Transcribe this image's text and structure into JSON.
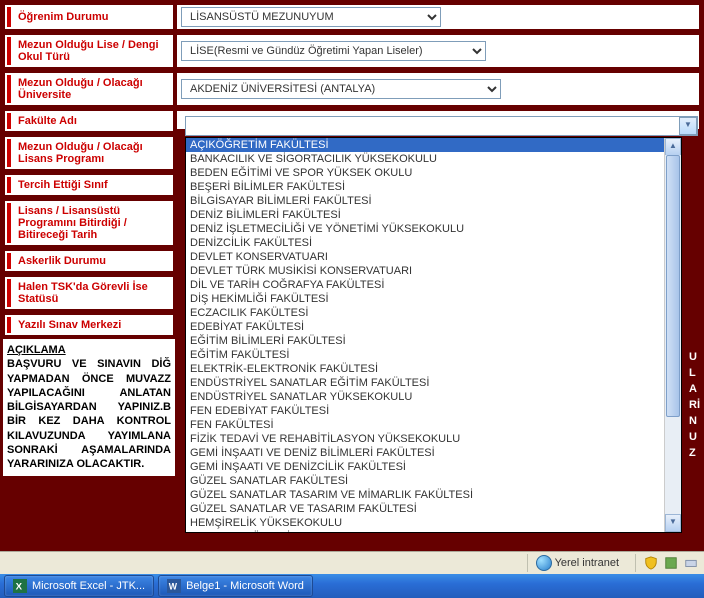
{
  "rows": {
    "ogrenim": {
      "label": "Öğrenim Durumu",
      "value": "LİSANSÜSTÜ MEZUNUYUM"
    },
    "lise": {
      "label": "Mezun Olduğu Lise / Dengi Okul Türü",
      "value": "LİSE(Resmi ve Gündüz Öğretimi Yapan Liseler)"
    },
    "uni": {
      "label": "Mezun Olduğu / Olacağı Üniversite",
      "value": "AKDENİZ ÜNİVERSİTESİ (ANTALYA)"
    },
    "fakulte": {
      "label": "Fakülte Adı",
      "value": ""
    },
    "program": {
      "label": "Mezun Olduğu / Olacağı Lisans Programı"
    },
    "tercih": {
      "label": "Tercih Ettiği Sınıf"
    },
    "bitir": {
      "label": "Lisans / Lisansüstü Programını Bitirdiği / Bitireceği Tarih"
    },
    "asker": {
      "label": "Askerlik Durumu"
    },
    "tsk": {
      "label": "Halen TSK'da Görevli İse Statüsü"
    },
    "merkez": {
      "label": "Yazılı Sınav Merkezi"
    }
  },
  "explain": {
    "title": "AÇIKLAMA",
    "body": "BAŞVURU VE SINAVIN DİĞ YAPMADAN ÖNCE MUVAZZ YAPILACAĞINI ANLATAN BİLGİSAYARDAN YAPINIZ.B BİR KEZ DAHA KONTROL KILAVUZUNDA YAYIMLANA SONRAKİ AŞAMALARINDA YARARINIZA OLACAKTIR."
  },
  "right_letters": [
    "U",
    "L",
    "A",
    "Rİ",
    "N",
    "U",
    "Z"
  ],
  "dropdown": {
    "selected": "AÇIKÖĞRETİM FAKÜLTESİ",
    "items": [
      "AÇIKÖĞRETİM FAKÜLTESİ",
      "BANKACILIK VE SİGORTACILIK YÜKSEKOKULU",
      "BEDEN EĞİTİMİ VE SPOR YÜKSEK OKULU",
      "BEŞERİ BİLİMLER FAKÜLTESİ",
      "BİLGİSAYAR BİLİMLERİ FAKÜLTESİ",
      "DENİZ BİLİMLERİ FAKÜLTESİ",
      "DENİZ İŞLETMECİLİĞİ VE YÖNETİMİ YÜKSEKOKULU",
      "DENİZCİLİK FAKÜLTESİ",
      "DEVLET KONSERVATUARI",
      "DEVLET TÜRK MUSİKİSİ KONSERVATUARI",
      "DİL VE TARİH COĞRAFYA FAKÜLTESİ",
      "DİŞ HEKİMLİĞİ FAKÜLTESİ",
      "ECZACILIK FAKÜLTESİ",
      "EDEBİYAT FAKÜLTESİ",
      "EĞİTİM BİLİMLERİ FAKÜLTESİ",
      "EĞİTİM FAKÜLTESİ",
      "ELEKTRİK-ELEKTRONİK FAKÜLTESİ",
      "ENDÜSTRİYEL SANATLAR EĞİTİM FAKÜLTESİ",
      "ENDÜSTRİYEL SANATLAR YÜKSEKOKULU",
      "FEN EDEBİYAT FAKÜLTESİ",
      "FEN FAKÜLTESİ",
      "FİZİK TEDAVİ VE REHABİTİLASYON YÜKSEKOKULU",
      "GEMİ İNŞAATI VE DENİZ BİLİMLERİ FAKÜLTESİ",
      "GEMİ İNŞAATI VE DENİZCİLİK FAKÜLTESİ",
      "GÜZEL SANATLAR FAKÜLTESİ",
      "GÜZEL SANATLAR TASARIM VE MİMARLIK FAKÜLTESİ",
      "GÜZEL SANATLAR VE TASARIM FAKÜLTESİ",
      "HEMŞİRELİK YÜKSEKOKULU",
      "HUKUK FAKÜLTESİ"
    ]
  },
  "status": {
    "zone": "Yerel intranet"
  },
  "taskbar": {
    "excel": "Microsoft Excel - JTK...",
    "word": "Belge1 - Microsoft Word"
  }
}
